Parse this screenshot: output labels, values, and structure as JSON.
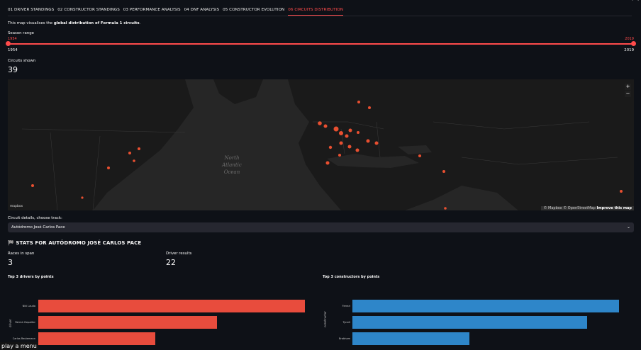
{
  "top_right": "display",
  "tabs": [
    {
      "label": "01 DRIVER STANDINGS",
      "active": false
    },
    {
      "label": "02 CONSTRUCTOR STANDINGS",
      "active": false
    },
    {
      "label": "03 PERFORMANCE ANALYSIS",
      "active": false
    },
    {
      "label": "04 DNF ANALYSIS",
      "active": false
    },
    {
      "label": "05 CONSTRUCTOR EVOLUTION",
      "active": false
    },
    {
      "label": "06 CIRCUITS DISTRIBUTION",
      "active": true
    }
  ],
  "intro": {
    "pre": "This map visualises the ",
    "bold": "global distribution of Formula 1 circuits",
    "post": "."
  },
  "slider": {
    "label": "Season range",
    "low": "1954",
    "high": "2019",
    "min": "1954",
    "max": "2019",
    "low_frac": 0,
    "high_frac": 1
  },
  "circuits": {
    "label": "Circuits shown",
    "value": "39"
  },
  "map": {
    "ocean_label_1": "North",
    "ocean_label_2": "Atlantic",
    "ocean_label_3": "Ocean",
    "zoom_in": "+",
    "zoom_out": "−",
    "logo": "mapbox",
    "attrib_1": "© Mapbox © OpenStreetMap",
    "attrib_2": "Improve this map",
    "marker_color": "#ff5533"
  },
  "select": {
    "label": "Circuit details, choose track:",
    "value": "Autódromo José Carlos Pace"
  },
  "section": {
    "icon": "chequered-flag-icon",
    "title": "STATS FOR AUTÓDROMO JOSÉ CARLOS PACE"
  },
  "races": {
    "label": "Races in span",
    "value": "3"
  },
  "results": {
    "label": "Driver results",
    "value": "22"
  },
  "chart_data": [
    {
      "type": "bar",
      "title": "Top 3 drivers by points",
      "ylabel": "driver",
      "categories": [
        "Niki Lauda",
        "Patrick Depailler",
        "Carlos Reutemann"
      ],
      "values": [
        1.0,
        0.67,
        0.44
      ],
      "color": "#e84c3d"
    },
    {
      "type": "bar",
      "title": "Top 3 constructors by points",
      "ylabel": "constructor",
      "categories": [
        "Ferrari",
        "Tyrrell",
        "Brabham"
      ],
      "values": [
        1.0,
        0.88,
        0.44
      ],
      "color": "#2e86c9"
    }
  ],
  "play_menu": "play a menu"
}
